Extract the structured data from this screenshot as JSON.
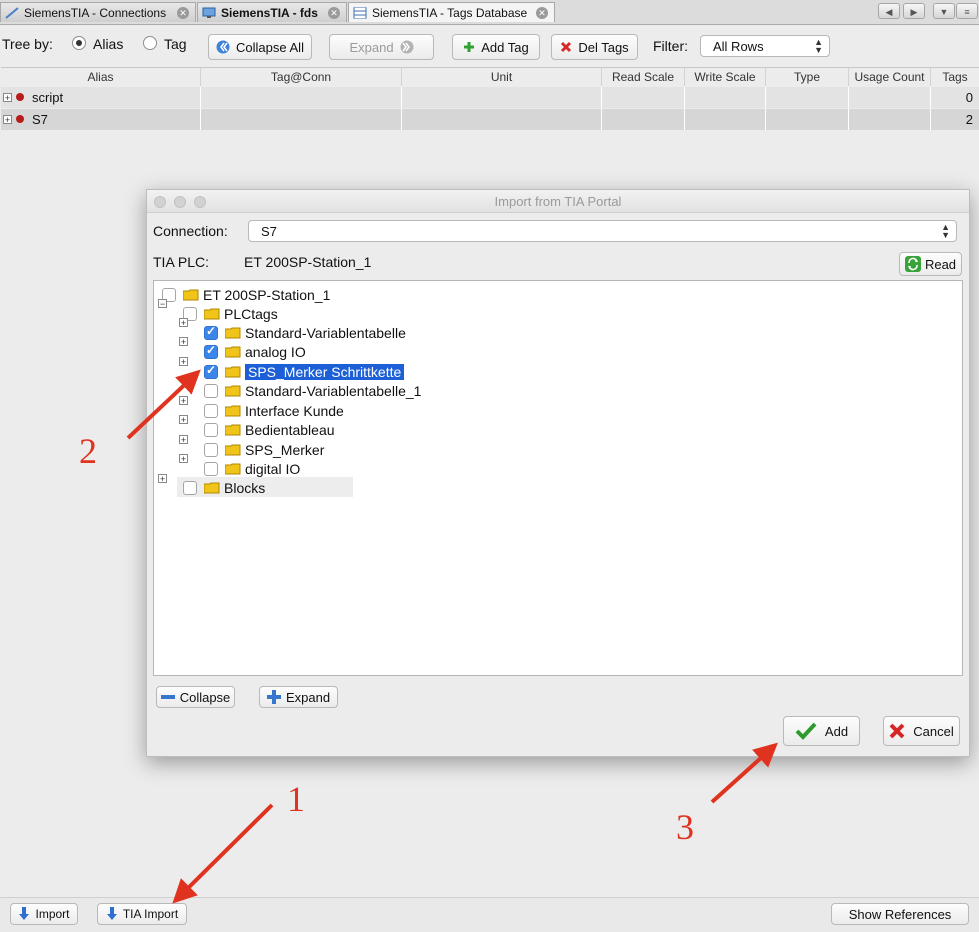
{
  "tabs": [
    {
      "label": "SiemensTIA - Connections",
      "active": false
    },
    {
      "label": "SiemensTIA - fds",
      "active": false
    },
    {
      "label": "SiemensTIA - Tags Database",
      "active": true
    }
  ],
  "toolbar": {
    "tree_by_label": "Tree by:",
    "alias_label": "Alias",
    "tag_label": "Tag",
    "collapse_all_label": "Collapse All",
    "expand_label": "Expand",
    "add_tag_label": "Add Tag",
    "del_tags_label": "Del Tags",
    "filter_label": "Filter:",
    "filter_value": "All Rows"
  },
  "table": {
    "columns": [
      "Alias",
      "Tag@Conn",
      "Unit",
      "Read Scale",
      "Write Scale",
      "Type",
      "Usage Count",
      "Tags"
    ],
    "rows": [
      {
        "alias": "script",
        "tags": "0"
      },
      {
        "alias": "S7",
        "tags": "2"
      }
    ]
  },
  "dialog": {
    "title": "Import from TIA Portal",
    "connection_label": "Connection:",
    "connection_value": "S7",
    "tia_plc_label": "TIA PLC:",
    "tia_plc_value": "ET 200SP-Station_1",
    "read_label": "Read",
    "tree": {
      "root": "ET 200SP-Station_1",
      "plctags": "PLCtags",
      "children": [
        {
          "label": "Standard-Variablentabelle",
          "checked": true
        },
        {
          "label": "analog IO",
          "checked": true
        },
        {
          "label": "SPS_Merker Schrittkette",
          "checked": true,
          "selected": true
        },
        {
          "label": "Standard-Variablentabelle_1",
          "checked": false
        },
        {
          "label": "Interface Kunde",
          "checked": false
        },
        {
          "label": "Bedientableau",
          "checked": false
        },
        {
          "label": "SPS_Merker",
          "checked": false
        },
        {
          "label": "digital IO",
          "checked": false
        }
      ],
      "blocks": "Blocks"
    },
    "collapse_label": "Collapse",
    "expand_label": "Expand",
    "add_label": "Add",
    "cancel_label": "Cancel"
  },
  "bottom": {
    "import_label": "Import",
    "tia_import_label": "TIA Import",
    "show_references_label": "Show References"
  },
  "annotations": [
    "1",
    "2",
    "3"
  ],
  "colors": {
    "annotation": "#e0331f",
    "selection": "#1d5fd6",
    "checkbox": "#3b86e8"
  }
}
